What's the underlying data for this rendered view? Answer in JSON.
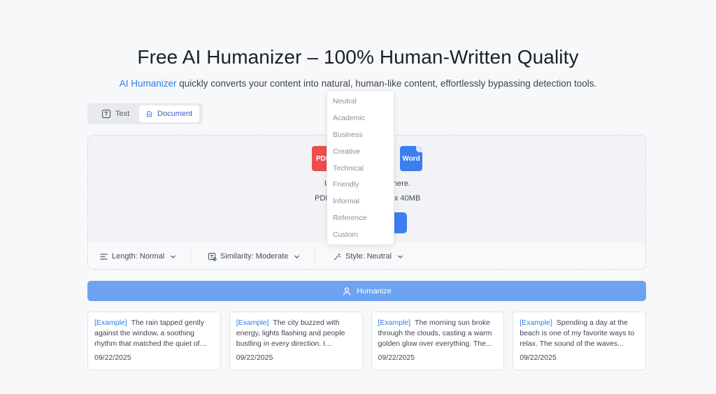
{
  "header": {
    "title": "Free AI Humanizer – 100% Human-Written Quality",
    "subtitle_accent": "AI Humanizer",
    "subtitle_rest": " quickly converts your content into natural, human-like content, effortlessly bypassing detection tools."
  },
  "mode_toggle": {
    "text_label": "Text",
    "document_label": "Document",
    "active": "Document"
  },
  "upload": {
    "pdf_label": "PDF",
    "word_label": "Word",
    "line1_left": "U",
    "line1_right": "here.",
    "line2_left": "PDF",
    "line2_right": "x 40MB"
  },
  "options": {
    "length": "Length: Normal",
    "similarity": "Similarity: Moderate",
    "style": "Style: Neutral"
  },
  "humanize_label": "Humanize",
  "examples": [
    {
      "tag": "[Example]",
      "text": "The rain tapped gently against the window, a soothing rhythm that matched the quiet of th...",
      "date": "09/22/2025"
    },
    {
      "tag": "[Example]",
      "text": "The city buzzed with energy, lights flashing and people bustling in every direction. I weaved...",
      "date": "09/22/2025"
    },
    {
      "tag": "[Example]",
      "text": "The morning sun broke through the clouds, casting a warm golden glow over everything. The...",
      "date": "09/22/2025"
    },
    {
      "tag": "[Example]",
      "text": "Spending a day at the beach is one of my favorite ways to relax. The sound of the waves...",
      "date": "09/22/2025"
    }
  ],
  "style_dropdown": [
    "Neutral",
    "Academic",
    "Business",
    "Creative",
    "Technical",
    "Friendly",
    "Informal",
    "Reference",
    "Custom"
  ],
  "colors": {
    "accent": "#2f7de1",
    "humanize_button": "#6ea3f3",
    "pdf": "#ee4d4d",
    "word": "#3c7ef0"
  }
}
